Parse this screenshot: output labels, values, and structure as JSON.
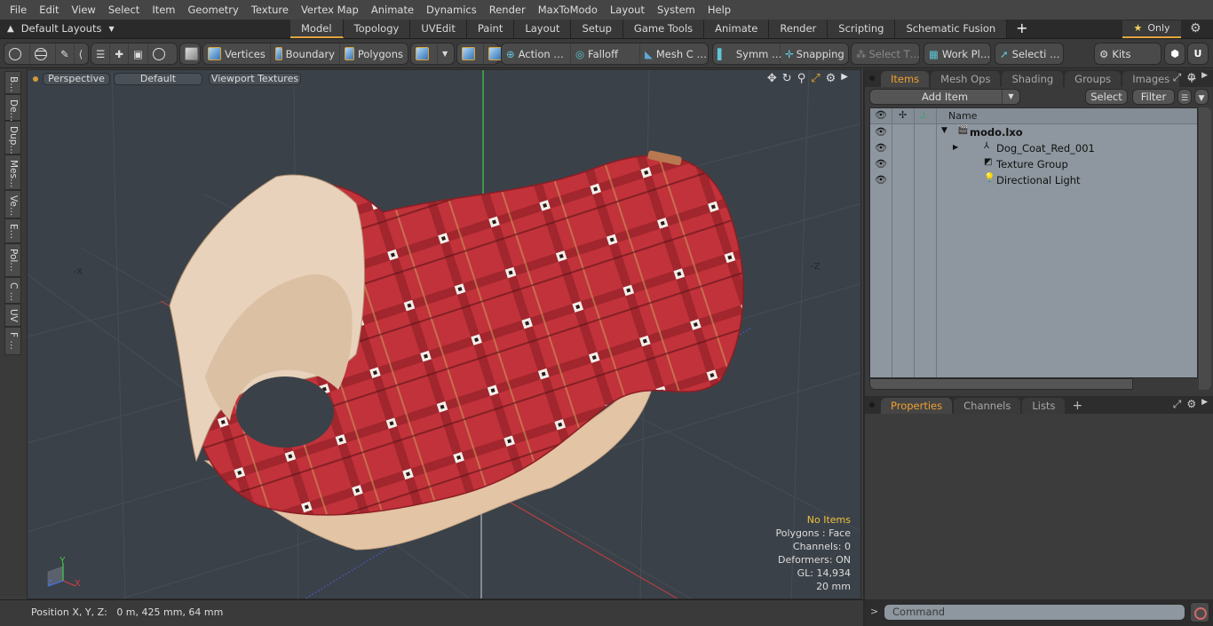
{
  "menu": [
    "File",
    "Edit",
    "View",
    "Select",
    "Item",
    "Geometry",
    "Texture",
    "Vertex Map",
    "Animate",
    "Dynamics",
    "Render",
    "MaxToModo",
    "Layout",
    "System",
    "Help"
  ],
  "layout_selector": {
    "label": "Default Layouts",
    "icon": "arrow-up-icon"
  },
  "layout_tabs": [
    {
      "label": "Model",
      "active": true
    },
    {
      "label": "Topology"
    },
    {
      "label": "UVEdit"
    },
    {
      "label": "Paint"
    },
    {
      "label": "Layout"
    },
    {
      "label": "Setup"
    },
    {
      "label": "Game Tools"
    },
    {
      "label": "Animate"
    },
    {
      "label": "Render"
    },
    {
      "label": "Scripting"
    },
    {
      "label": "Schematic Fusion"
    }
  ],
  "layout_tab_add": "+",
  "only_button": {
    "label": "Only",
    "icon": "star-icon"
  },
  "toolbar": {
    "select_modes": [
      "Vertices",
      "Boundary",
      "Polygons"
    ],
    "action": "Action …",
    "falloff": "Falloff",
    "mesh_constraints": "Mesh C …",
    "symmetry": "Symm …",
    "snapping": "Snapping",
    "select_through": "Select T…",
    "work_plane": "Work Pl…",
    "selection_sets": "Selecti …",
    "kits": "Kits"
  },
  "left_tabs": [
    "B…",
    "De…",
    "Dup…",
    "Mes…",
    "Ve…",
    "E…",
    "Pol…",
    "C …",
    "UV",
    "F …"
  ],
  "viewport": {
    "view": "Perspective",
    "shading": "Default",
    "textures": "Viewport Textures",
    "axis_labels": {
      "neg_x": "-X",
      "neg_z": "-Z"
    },
    "info": {
      "selection": "No Items",
      "mode": "Polygons : Face",
      "channels": "Channels: 0",
      "deformers": "Deformers: ON",
      "gl": "GL: 14,934",
      "grid": "20 mm"
    },
    "gizmo": {
      "x": "X",
      "y": "Y",
      "z": "Z"
    }
  },
  "status": {
    "position_label": "Position X, Y, Z:",
    "position_value": "0 m, 425 mm, 64 mm"
  },
  "items_panel": {
    "tabs": [
      {
        "label": "Items",
        "active": true
      },
      {
        "label": "Mesh Ops"
      },
      {
        "label": "Shading"
      },
      {
        "label": "Groups"
      },
      {
        "label": "Images"
      }
    ],
    "add_item": "Add Item",
    "select": "Select",
    "filter": "Filter",
    "column_name": "Name",
    "tree": [
      {
        "label": "modo.lxo",
        "icon": "scene-icon",
        "depth": 0,
        "bold": true
      },
      {
        "label": "Dog_Coat_Red_001",
        "icon": "mesh-locator-icon",
        "depth": 1
      },
      {
        "label": "Texture Group",
        "icon": "texture-group-icon",
        "depth": 1
      },
      {
        "label": "Directional Light",
        "icon": "light-icon",
        "depth": 1
      }
    ]
  },
  "properties_panel": {
    "tabs": [
      {
        "label": "Properties",
        "active": true
      },
      {
        "label": "Channels"
      },
      {
        "label": "Lists"
      }
    ]
  },
  "command": {
    "placeholder": "Command",
    "prompt": ">"
  },
  "colors": {
    "accent": "#e2a440",
    "active_tab_text": "#f0a030",
    "warn_text": "#f0c040",
    "tree_bg": "#8e979f",
    "viewport_bg": "#3b4148",
    "coat_red": "#c2323a",
    "coat_lining": "#e3c4a4"
  }
}
